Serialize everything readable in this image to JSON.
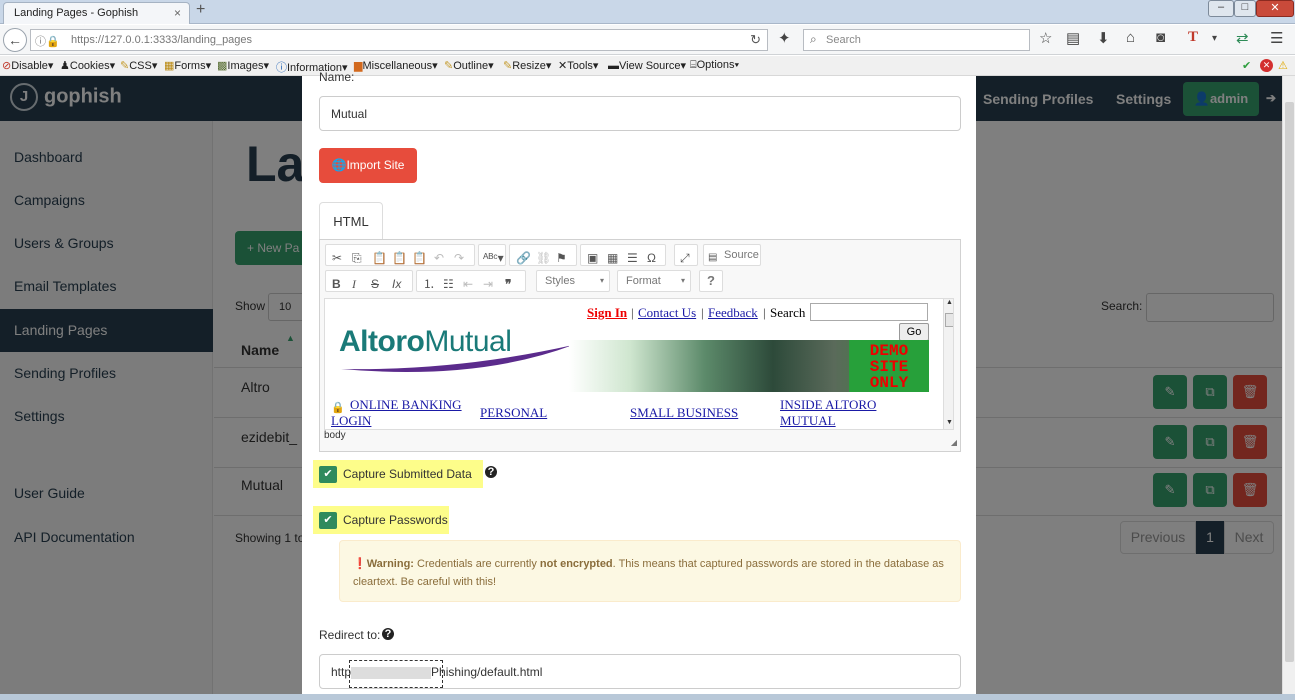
{
  "browser": {
    "tab_title": "Landing Pages - Gophish",
    "tab_close": "×",
    "new_tab": "+",
    "url": "https://127.0.0.1:3333/landing_pages",
    "search_placeholder": "Search",
    "dev_toolbar": [
      "Disable▾",
      "Cookies▾",
      "CSS▾",
      "Forms▾",
      "Images▾",
      "Information▾",
      "Miscellaneous▾",
      "Outline▾",
      "Resize▾",
      "Tools▾",
      "View Source▾",
      "Options▾"
    ]
  },
  "app": {
    "logo": "gophish",
    "topnav": {
      "sending_profiles": "Sending Profiles",
      "settings": "Settings",
      "admin": "admin"
    },
    "sidebar": {
      "items": [
        "Dashboard",
        "Campaigns",
        "Users & Groups",
        "Email Templates",
        "Landing Pages",
        "Sending Profiles",
        "Settings"
      ],
      "active": "Landing Pages",
      "user_guide": "User Guide",
      "api_docs": "API Documentation"
    },
    "page": {
      "title_partial": "La",
      "new_page_partial": "+ New Pa",
      "show_label": "Show",
      "show_value": "10",
      "search_label": "Search:",
      "col_name": "Name",
      "rows": [
        "Altro",
        "ezidebit_",
        "Mutual"
      ],
      "showing_partial": "Showing 1 to",
      "pagination": {
        "previous": "Previous",
        "current": "1",
        "next": "Next"
      }
    }
  },
  "modal": {
    "name_label": "Name:",
    "name_value": "Mutual",
    "import_site": "Import Site",
    "html_tab": "HTML",
    "editor": {
      "source_btn": "Source",
      "styles": "Styles",
      "format": "Format",
      "help": "?",
      "status_path": "body"
    },
    "preview": {
      "sign_in": "Sign In",
      "contact_us": "Contact Us",
      "feedback": "Feedback",
      "search": "Search",
      "go": "Go",
      "logo_text_1": "Altoro",
      "logo_text_2": "Mutual",
      "demo_line1": "DEMO",
      "demo_line2": "SITE",
      "demo_line3": "ONLY",
      "nav1a": "ONLINE BANKING",
      "nav1b": "LOGIN",
      "nav2": "PERSONAL",
      "nav3": "SMALL BUSINESS",
      "nav4a": "INSIDE ALTORO",
      "nav4b": "MUTUAL"
    },
    "capture_submitted": "Capture Submitted Data",
    "capture_passwords": "Capture Passwords",
    "warning": {
      "label": "Warning:",
      "text1": "Credentials are currently",
      "bold": "not encrypted",
      "text2": ". This means that captured passwords are stored in the database as cleartext. Be careful with this!"
    },
    "redirect_label": "Redirect to:",
    "redirect_value_start": "http",
    "redirect_value_end": "Phishing/default.html"
  },
  "colors": {
    "navy": "#283f50",
    "green": "#37a26f",
    "red": "#e74c3c",
    "highlight": "#fdfd8a"
  }
}
